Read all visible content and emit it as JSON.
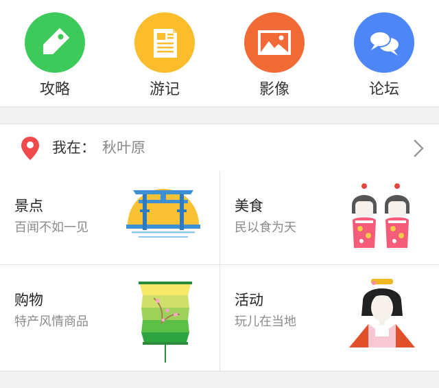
{
  "nav": {
    "items": [
      {
        "label": "攻略",
        "icon": "price-tag-icon",
        "color": "#3ec95b"
      },
      {
        "label": "游记",
        "icon": "document-icon",
        "color": "#fbbd2b"
      },
      {
        "label": "影像",
        "icon": "image-icon",
        "color": "#f26a36"
      },
      {
        "label": "论坛",
        "icon": "chat-bubbles-icon",
        "color": "#4f86f7"
      }
    ]
  },
  "location": {
    "label": "我在：",
    "value": "秋叶原",
    "pin_color": "#f24b4b"
  },
  "categories": [
    {
      "title": "景点",
      "subtitle": "百闻不如一见",
      "image": "torii-gate-illustration"
    },
    {
      "title": "美食",
      "subtitle": "民以食为天",
      "image": "kokeshi-dolls-illustration"
    },
    {
      "title": "购物",
      "subtitle": "特产风情商品",
      "image": "paper-lantern-illustration"
    },
    {
      "title": "活动",
      "subtitle": "玩儿在当地",
      "image": "geisha-illustration"
    }
  ]
}
